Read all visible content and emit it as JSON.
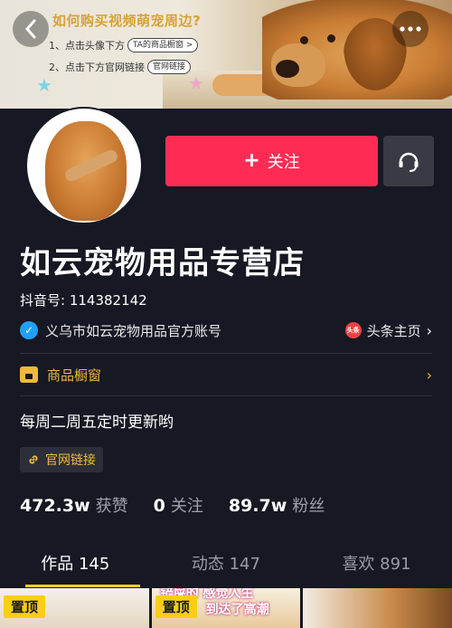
{
  "banner": {
    "promo_title": "如何购买视频萌宠周边?",
    "step1": "1、点击头像下方",
    "step1_pill": "TA的商品橱窗 >",
    "step2": "2、点击下方官网链接",
    "step2_pill": "官网链接",
    "back_icon": "chevron-left-icon",
    "more_icon": "more-dots-icon"
  },
  "profile": {
    "follow_label": "关注",
    "store_name": "如云宠物用品专营店",
    "douyin_id": "抖音号: 114382142",
    "verified_text": "义乌市如云宠物用品官方账号",
    "toutiao_logo": "头条",
    "toutiao_label": "头条主页",
    "shop_label": "商品橱窗",
    "bio": "每周二周五定时更新哟",
    "link_label": "官网链接"
  },
  "stats": [
    {
      "value": "472.3w",
      "label": "获赞"
    },
    {
      "value": "0",
      "label": "关注"
    },
    {
      "value": "89.7w",
      "label": "粉丝"
    }
  ],
  "tabs": [
    {
      "label": "作品 145",
      "active": true
    },
    {
      "label": "动态 147",
      "active": false
    },
    {
      "label": "喜欢 891",
      "active": false
    }
  ],
  "grid": {
    "pin_label": "置顶",
    "caption_line1": "铲屎的 感觉人生",
    "caption_line2": "到达了高潮"
  },
  "colors": {
    "background": "#161823",
    "follow": "#fe2c55",
    "accent_yellow": "#face15",
    "shop_gold": "#f1b83a",
    "verify_blue": "#20a0ff"
  }
}
